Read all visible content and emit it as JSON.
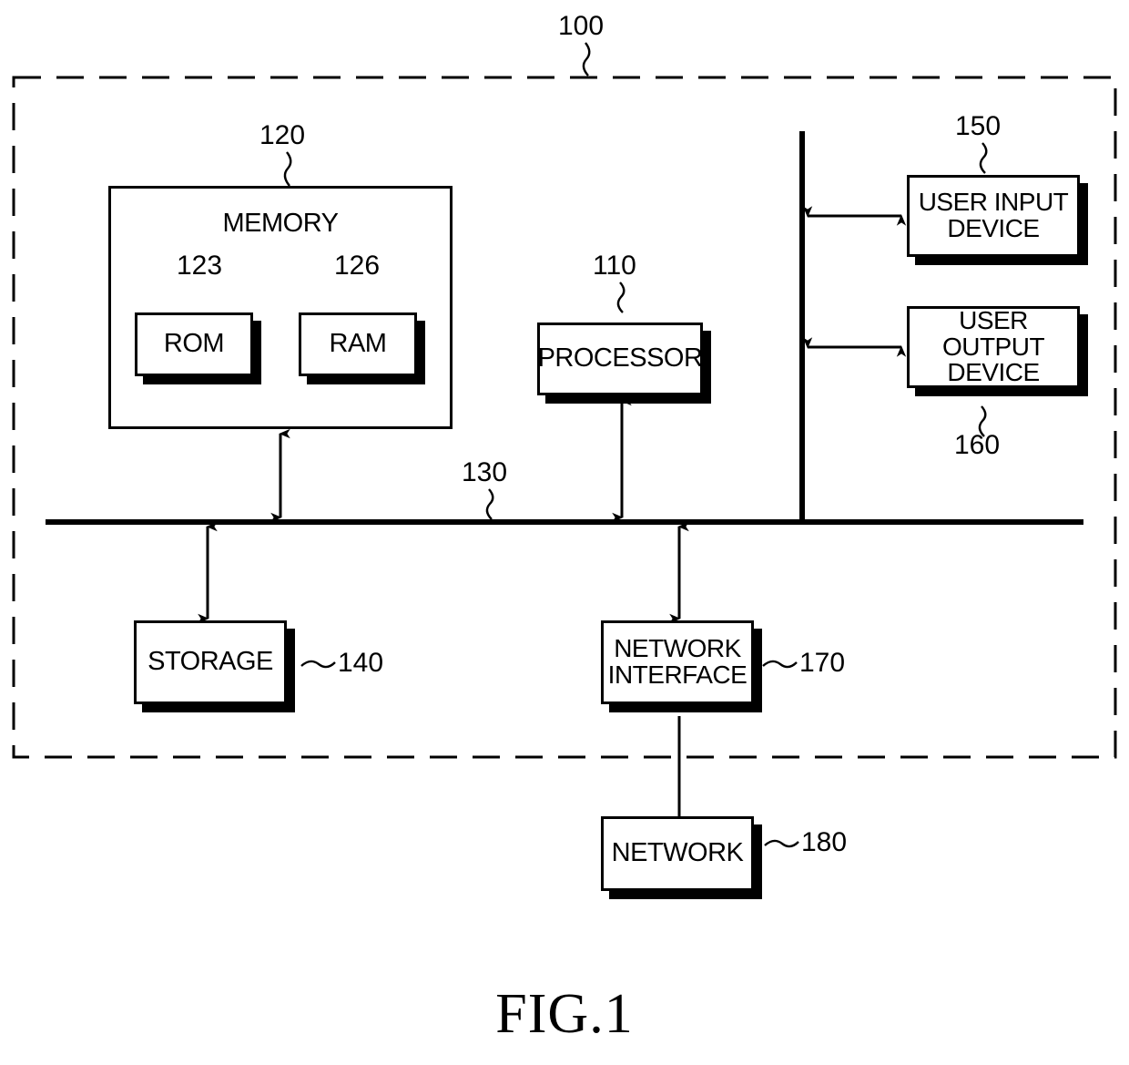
{
  "figure": {
    "caption": "FIG.1",
    "system_numeral": "100"
  },
  "boundary": {
    "name": "computer-system-boundary",
    "style": "dashed",
    "numeral": "100"
  },
  "bus": {
    "label_numeral": "130",
    "name": "system-bus"
  },
  "blocks": {
    "memory": {
      "title": "MEMORY",
      "numeral": "120"
    },
    "rom": {
      "label": "ROM",
      "numeral": "123"
    },
    "ram": {
      "label": "RAM",
      "numeral": "126"
    },
    "processor": {
      "label": "PROCESSOR",
      "numeral": "110"
    },
    "user_input_device": {
      "label": "USER INPUT\nDEVICE",
      "numeral": "150"
    },
    "user_output_device": {
      "label": "USER OUTPUT\nDEVICE",
      "numeral": "160"
    },
    "storage": {
      "label": "STORAGE",
      "numeral": "140"
    },
    "network_interface": {
      "label": "NETWORK\nINTERFACE",
      "numeral": "170"
    },
    "network": {
      "label": "NETWORK",
      "numeral": "180"
    }
  },
  "colors": {
    "ink": "#000000",
    "paper": "#ffffff"
  }
}
